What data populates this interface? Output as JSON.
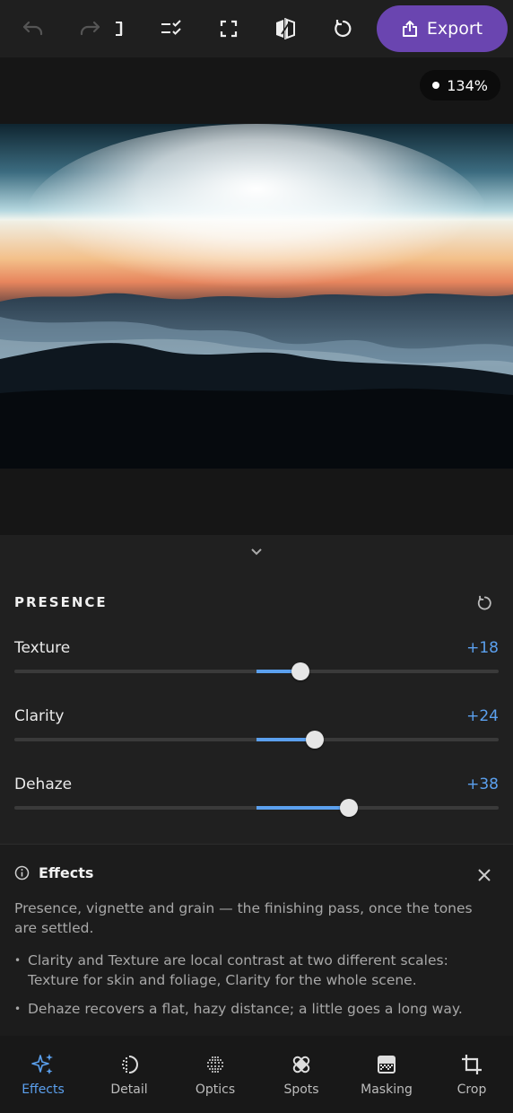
{
  "toolbar": {
    "icons": [
      "undo-icon",
      "redo-icon",
      "panel-toggle-icon",
      "checklist-icon",
      "fullscreen-icon",
      "compare-icon",
      "reset-icon"
    ],
    "export_label": "Export",
    "accent": "#6a45b0"
  },
  "viewer": {
    "zoom": "134%"
  },
  "presence": {
    "title": "PRESENCE",
    "sliders": [
      {
        "label": "Texture",
        "value": "+18",
        "amount": 18
      },
      {
        "label": "Clarity",
        "value": "+24",
        "amount": 24
      },
      {
        "label": "Dehaze",
        "value": "+38",
        "amount": 38
      }
    ],
    "range": [
      -100,
      100
    ],
    "slider_color": "#5ba0ee"
  },
  "info": {
    "title": "Effects",
    "text": "Presence, vignette and grain — the finishing pass, once the tones are settled.",
    "bullets": [
      "Clarity and Texture are local contrast at two different scales: Texture for skin and foliage, Clarity for the whole scene.",
      "Dehaze recovers a flat, hazy distance; a little goes a long way."
    ]
  },
  "nav": {
    "items": [
      {
        "label": "Effects",
        "icon": "sparkles-icon",
        "active": true
      },
      {
        "label": "Detail",
        "icon": "detail-icon",
        "active": false
      },
      {
        "label": "Optics",
        "icon": "optics-icon",
        "active": false
      },
      {
        "label": "Spots",
        "icon": "bandage-icon",
        "active": false
      },
      {
        "label": "Masking",
        "icon": "masking-icon",
        "active": false
      },
      {
        "label": "Crop",
        "icon": "crop-icon",
        "active": false
      }
    ]
  }
}
